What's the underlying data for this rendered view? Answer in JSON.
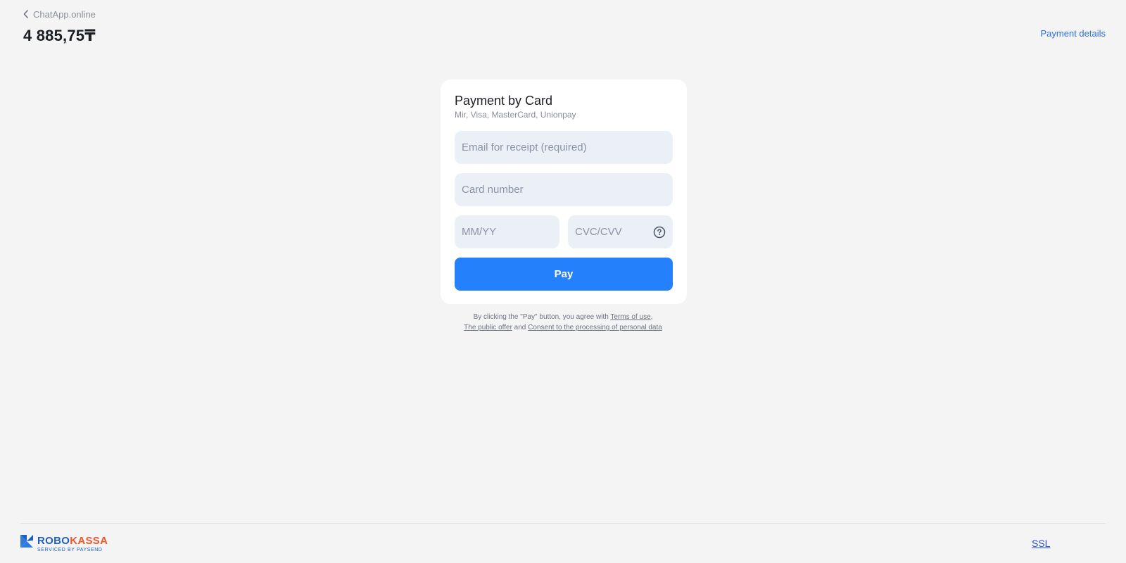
{
  "header": {
    "back_label": "ChatApp.online",
    "amount": "4 885,75₸",
    "payment_details_label": "Payment details"
  },
  "card": {
    "title": "Payment by Card",
    "subtitle": "Mir, Visa, MasterCard, Unionpay",
    "email": {
      "placeholder": "Email for receipt (required)",
      "value": ""
    },
    "card_number": {
      "placeholder": "Card number",
      "value": ""
    },
    "expiry": {
      "placeholder": "MM/YY",
      "value": ""
    },
    "cvc": {
      "placeholder": "CVC/CVV",
      "value": ""
    },
    "pay_label": "Pay"
  },
  "agreement": {
    "prefix": "By clicking the \"Pay\" button, you agree with ",
    "terms_label": "Terms of use",
    "comma": ",",
    "offer_label": "The public offer",
    "and_text": " and ",
    "consent_label": "Consent to the processing of personal data"
  },
  "footer": {
    "logo_robo": "ROBO",
    "logo_kassa": "KASSA",
    "logo_sub": "SERVICED BY PAYSEND",
    "ssl_alt": "SSL"
  },
  "colors": {
    "accent": "#2480fb",
    "link": "#2d6fe4",
    "background": "#f4f4f4",
    "field_bg": "#ebf0f7",
    "logo_blue": "#1f5fbf",
    "logo_orange": "#f0572a"
  },
  "icons": {
    "back": "chevron-left-icon",
    "help": "question-circle-icon",
    "logo_mark": "robokassa-k-icon"
  }
}
